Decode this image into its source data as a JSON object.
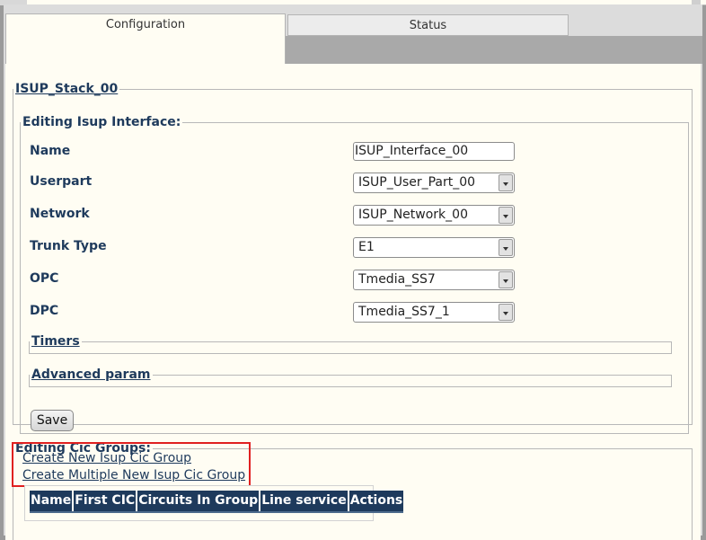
{
  "tabs": [
    {
      "label": "Configuration",
      "active": true
    },
    {
      "label": "Status",
      "active": false
    }
  ],
  "stack": {
    "title": "ISUP_Stack_00"
  },
  "interface_editor": {
    "title": "Editing Isup Interface:",
    "fields": [
      {
        "label": "Name",
        "type": "text",
        "value": "ISUP_Interface_00"
      },
      {
        "label": "Userpart",
        "type": "select",
        "value": "ISUP_User_Part_00"
      },
      {
        "label": "Network",
        "type": "select",
        "value": "ISUP_Network_00"
      },
      {
        "label": "Trunk Type",
        "type": "select",
        "value": "E1"
      },
      {
        "label": "OPC",
        "type": "select",
        "value": "Tmedia_SS7"
      },
      {
        "label": "DPC",
        "type": "select",
        "value": "Tmedia_SS7_1"
      }
    ],
    "timers_label": "Timers",
    "advanced_label": "Advanced param",
    "save_label": "Save"
  },
  "cic_groups": {
    "title": "Editing Cic Groups:",
    "create_link": "Create New Isup Cic Group",
    "create_multiple_link": "Create Multiple New Isup Cic Group",
    "columns": [
      "Name",
      "First CIC",
      "Circuits In Group",
      "Line service",
      "Actions"
    ]
  },
  "colors": {
    "text": "#1e3a5c",
    "panel_bg": "#fffdf3",
    "table_header_bg": "#1e3a5c",
    "highlight_box": "#e02020"
  }
}
